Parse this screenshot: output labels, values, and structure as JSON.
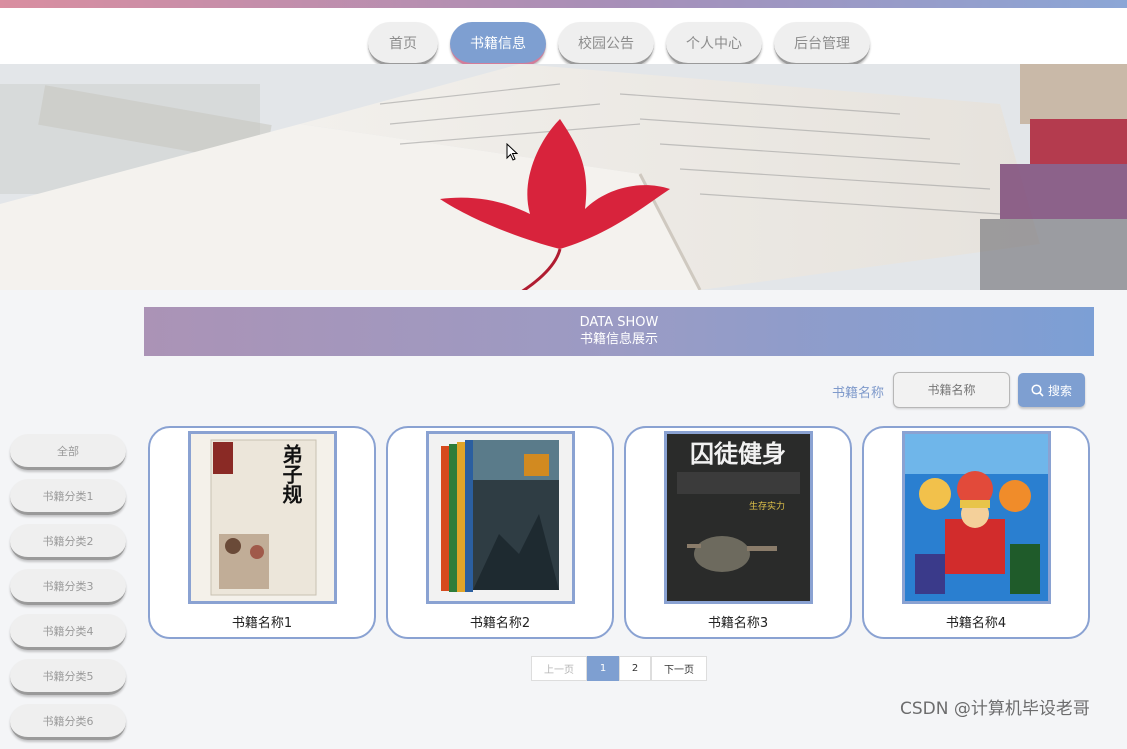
{
  "nav": {
    "items": [
      {
        "label": "首页",
        "active": false
      },
      {
        "label": "书籍信息",
        "active": true
      },
      {
        "label": "校园公告",
        "active": false
      },
      {
        "label": "个人中心",
        "active": false
      },
      {
        "label": "后台管理",
        "active": false
      }
    ]
  },
  "section": {
    "title_en": "DATA SHOW",
    "title_cn": "书籍信息展示"
  },
  "search": {
    "label": "书籍名称",
    "placeholder": "书籍名称",
    "button_label": "搜索"
  },
  "categories": [
    "全部",
    "书籍分类1",
    "书籍分类2",
    "书籍分类3",
    "书籍分类4",
    "书籍分类5",
    "书籍分类6"
  ],
  "books": [
    {
      "name": "书籍名称1",
      "cover_text": "弟子规"
    },
    {
      "name": "书籍名称2",
      "cover_text": ""
    },
    {
      "name": "书籍名称3",
      "cover_text": "囚徒健身",
      "cover_sub": "生存实力"
    },
    {
      "name": "书籍名称4",
      "cover_text": ""
    }
  ],
  "pagination": {
    "prev": "上一页",
    "pages": [
      "1",
      "2"
    ],
    "current": "1",
    "next": "下一页"
  },
  "watermark": "CSDN @计算机毕设老哥",
  "colors": {
    "accent": "#7e9fd1",
    "accent_pink": "#d27d9a",
    "card_border": "#8aa2d2"
  }
}
